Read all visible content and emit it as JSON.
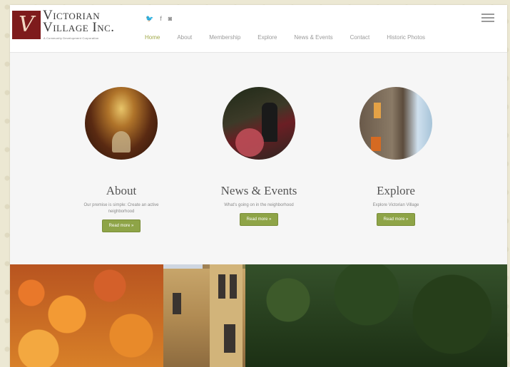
{
  "brand": {
    "monogram": "V",
    "name_line1": "Victorian",
    "name_line2": "Village Inc.",
    "tagline": "A Community Development Corporation"
  },
  "social": [
    {
      "icon": "twitter-icon",
      "glyph": "🐦"
    },
    {
      "icon": "facebook-icon",
      "glyph": "f"
    },
    {
      "icon": "instagram-icon",
      "glyph": "◙"
    }
  ],
  "nav": {
    "items": [
      "Home",
      "About",
      "Membership",
      "Explore",
      "News & Events",
      "Contact",
      "Historic Photos"
    ],
    "active": "Home"
  },
  "features": [
    {
      "title": "About",
      "description": "Our premise is simple: Create an active neighborhood",
      "button": "Read more »"
    },
    {
      "title": "News & Events",
      "description": "What's going on in the neighborhood",
      "button": "Read more »"
    },
    {
      "title": "Explore",
      "description": "Explore Victorian Village",
      "button": "Read more »"
    }
  ],
  "colors": {
    "brand_red": "#7e1b1c",
    "accent_green": "#8ea447",
    "nav_active": "#a1a94a"
  }
}
